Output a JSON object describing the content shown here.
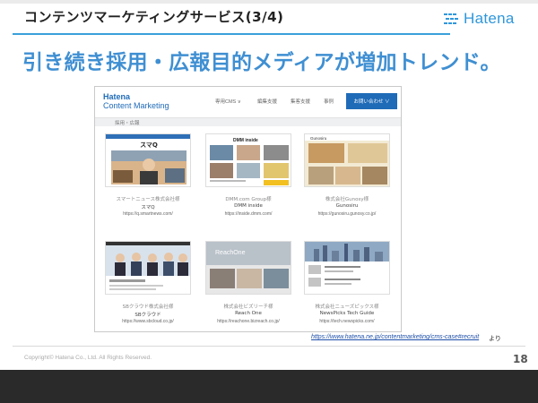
{
  "header": {
    "title": "コンテンツマーケティングサービス(3/4)",
    "logo_text": "Hatena"
  },
  "headline": "引き続き採用・広報目的メディアが増加トレンド。",
  "screenshot": {
    "brand_line1": "Hatena",
    "brand_line2": "Content Marketing",
    "nav": [
      "専用CMS ∨",
      "編集支援",
      "集客支援",
      "事例"
    ],
    "cta": "お問い合わせ ∨",
    "category": "採用・広報",
    "cards": [
      {
        "company": "スマートニュース株式会社様",
        "name": "スマQ",
        "url": "https://q.smartnews.com/"
      },
      {
        "company": "DMM.com Group様",
        "name": "DMM inside",
        "url": "https://inside.dmm.com/"
      },
      {
        "company": "株式会社Gunosy様",
        "name": "Gunosiru",
        "url": "https://gunosiru.gunosy.co.jp/"
      },
      {
        "company": "SBクラウド株式会社様",
        "name": "SBクラウド",
        "url": "https://www.sbcloud.co.jp/"
      },
      {
        "company": "株式会社ビズリーチ様",
        "name": "Reach One",
        "url": "https://reachone.bizreach.co.jp/"
      },
      {
        "company": "株式会社ニューズピックス様",
        "name": "NewsPicks Tech Guide",
        "url": "https://tech.newspicks.com/"
      }
    ],
    "thumb_titles": [
      "スマQ",
      "DMM inside",
      "Gunosiru",
      "",
      "ReachOne",
      ""
    ]
  },
  "source": {
    "url": "https://www.hatena.ne.jp/contentmarketing/cms-case#recruit",
    "suffix": "より"
  },
  "footer": {
    "copyright": "Copyright© Hatena Co., Ltd.   All Rights Reserved.",
    "page_number": "18"
  },
  "colors": {
    "accent": "#3f8fd2",
    "brand": "#1f6bb8",
    "rule": "#3aa0db"
  }
}
